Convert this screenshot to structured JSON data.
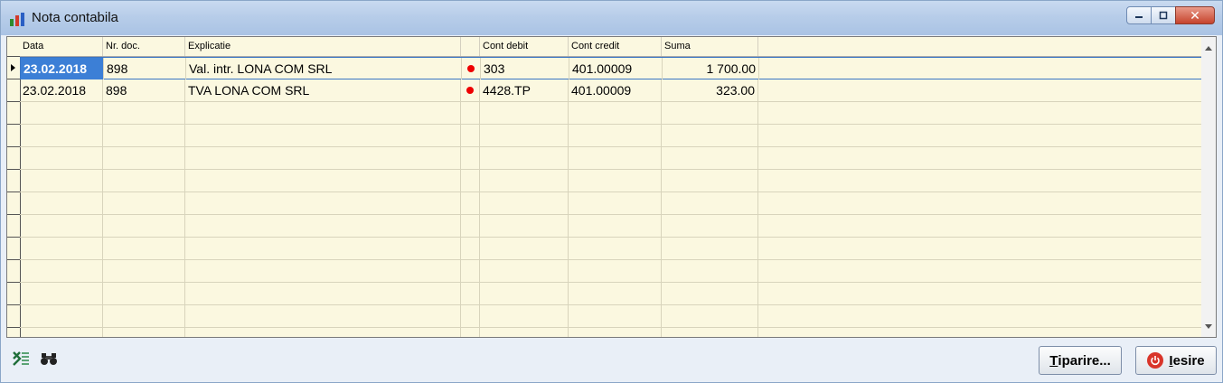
{
  "window": {
    "title": "Nota contabila",
    "close_glyph": "✕"
  },
  "grid": {
    "columns": [
      {
        "key": "data",
        "label": "Data"
      },
      {
        "key": "nr_doc",
        "label": "Nr. doc."
      },
      {
        "key": "explicatie",
        "label": "Explicatie"
      },
      {
        "key": "flag",
        "label": ""
      },
      {
        "key": "cont_debit",
        "label": "Cont debit"
      },
      {
        "key": "cont_credit",
        "label": "Cont credit"
      },
      {
        "key": "suma",
        "label": "Suma"
      }
    ],
    "rows": [
      {
        "data": "23.02.2018",
        "nr_doc": "898",
        "explicatie": "Val. intr. LONA COM SRL",
        "cont_debit": "303",
        "cont_credit": "401.00009",
        "suma": "1 700.00"
      },
      {
        "data": "23.02.2018",
        "nr_doc": "898",
        "explicatie": "TVA LONA COM SRL",
        "cont_debit": "4428.TP",
        "cont_credit": "401.00009",
        "suma": "323.00"
      }
    ],
    "selected_row": 0
  },
  "toolbar": {
    "excel_icon": "excel-export-icon",
    "search_icon": "binoculars-icon"
  },
  "buttons": {
    "print_label_first": "T",
    "print_label_rest": "iparire...",
    "exit_label_first": "I",
    "exit_label_rest": "esire"
  },
  "colors": {
    "grid_bg": "#fbf8e0",
    "selection": "#3c7fd6",
    "flag_dot": "#e00000"
  }
}
